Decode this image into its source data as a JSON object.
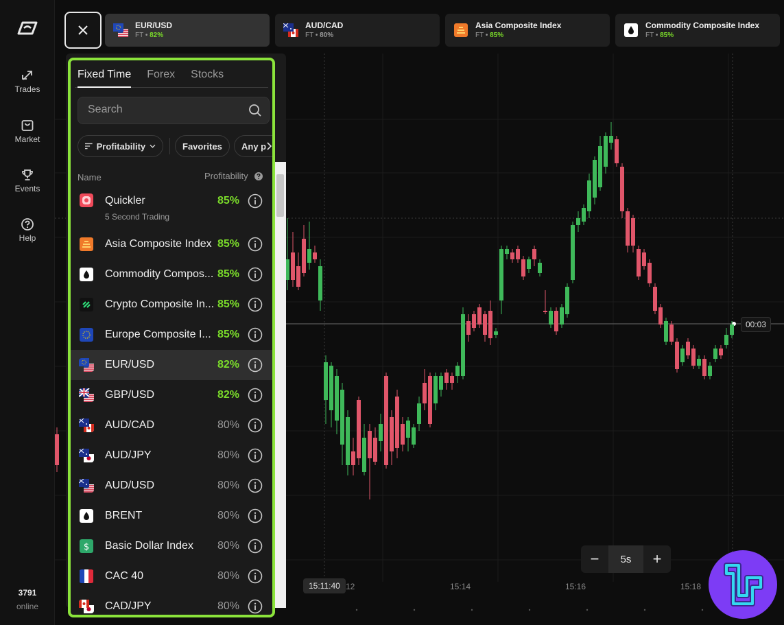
{
  "sidebar": {
    "items": [
      {
        "label": "Trades",
        "icon": "trades-arrows-icon"
      },
      {
        "label": "Market",
        "icon": "market-bag-icon"
      },
      {
        "label": "Events",
        "icon": "trophy-icon"
      },
      {
        "label": "Help",
        "icon": "help-circle-icon"
      }
    ],
    "online_count": "3791",
    "online_label": "online"
  },
  "top_tabs": [
    {
      "name": "EUR/USD",
      "mode": "FT",
      "pct": "82%",
      "icon": "eu-us-flag-icon",
      "active": true
    },
    {
      "name": "AUD/CAD",
      "mode": "FT",
      "pct": "80%",
      "icon": "au-ca-flag-icon",
      "active": false
    },
    {
      "name": "Asia Composite Index",
      "mode": "FT",
      "pct": "85%",
      "icon": "asia-composite-icon",
      "active": false
    },
    {
      "name": "Commodity Composite Index",
      "mode": "FT",
      "pct": "85%",
      "icon": "commodity-drop-icon",
      "active": false
    }
  ],
  "tab_separator": " • ",
  "panel": {
    "tabs": [
      "Fixed Time",
      "Forex",
      "Stocks"
    ],
    "search_placeholder": "Search",
    "filters": {
      "sort": "Profitability",
      "favorites": "Favorites",
      "any": "Any p"
    },
    "col_name": "Name",
    "col_profit": "Profitability",
    "assets": [
      {
        "name": "Quickler",
        "sub": "5 Second Trading",
        "pct": "85%",
        "high": true,
        "icon": "quickler-icon"
      },
      {
        "name": "Asia Composite Index",
        "pct": "85%",
        "high": true,
        "icon": "asia-composite-icon"
      },
      {
        "name": "Commodity Compos...",
        "pct": "85%",
        "high": true,
        "icon": "commodity-drop-icon"
      },
      {
        "name": "Crypto Composite In...",
        "pct": "85%",
        "high": true,
        "icon": "crypto-composite-icon"
      },
      {
        "name": "Europe Composite I...",
        "pct": "85%",
        "high": true,
        "icon": "europe-stars-icon"
      },
      {
        "name": "EUR/USD",
        "pct": "82%",
        "high": true,
        "icon": "eu-us-flag-icon",
        "selected": true
      },
      {
        "name": "GBP/USD",
        "pct": "82%",
        "high": true,
        "icon": "gb-us-flag-icon"
      },
      {
        "name": "AUD/CAD",
        "pct": "80%",
        "high": false,
        "icon": "au-ca-flag-icon"
      },
      {
        "name": "AUD/JPY",
        "pct": "80%",
        "high": false,
        "icon": "au-jp-flag-icon"
      },
      {
        "name": "AUD/USD",
        "pct": "80%",
        "high": false,
        "icon": "au-us-flag-icon"
      },
      {
        "name": "BRENT",
        "pct": "80%",
        "high": false,
        "icon": "oil-drop-icon"
      },
      {
        "name": "Basic Dollar Index",
        "pct": "80%",
        "high": false,
        "icon": "dollar-icon"
      },
      {
        "name": "CAC 40",
        "pct": "80%",
        "high": false,
        "icon": "fr-flag-icon"
      },
      {
        "name": "CAD/JPY",
        "pct": "80%",
        "high": false,
        "icon": "ca-jp-flag-icon"
      }
    ]
  },
  "chart": {
    "countdown": "00:03",
    "cursor_time": "15:11:40",
    "x_ticks": [
      "12",
      "15:14",
      "15:16",
      "15:18"
    ],
    "timeframe": "5s",
    "zoom_minus": "−",
    "zoom_plus": "+",
    "up_color": "#3fb95a",
    "down_color": "#e0566a"
  }
}
